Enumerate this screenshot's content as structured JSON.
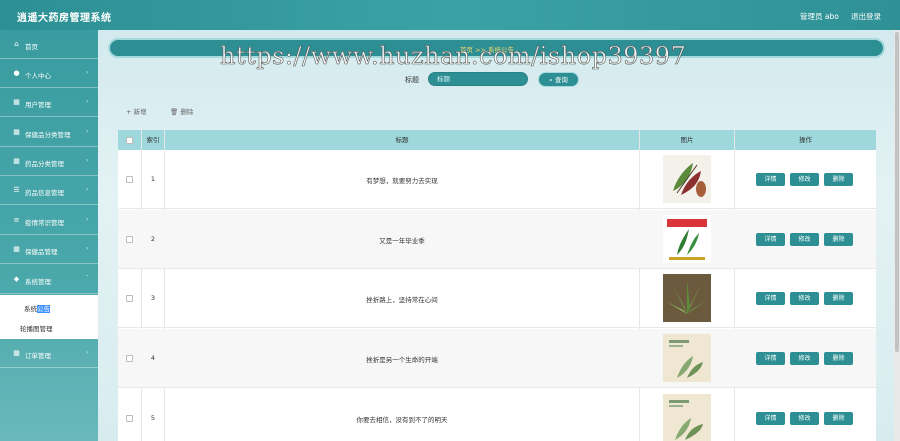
{
  "header": {
    "title": "逍遥大药房管理系统",
    "user_label": "管理员 abo",
    "logout_label": "退出登录"
  },
  "sidebar": {
    "items": [
      {
        "label": "首页",
        "icon": "home-icon"
      },
      {
        "label": "个人中心",
        "icon": "user-icon"
      },
      {
        "label": "用户管理",
        "icon": "grid-icon"
      },
      {
        "label": "保健品分类管理",
        "icon": "grid-icon"
      },
      {
        "label": "药品分类管理",
        "icon": "grid-icon"
      },
      {
        "label": "药品信息管理",
        "icon": "sliders-icon"
      },
      {
        "label": "疫情常识管理",
        "icon": "list-icon"
      },
      {
        "label": "保健品管理",
        "icon": "grid-icon"
      },
      {
        "label": "系统管理",
        "icon": "shield-icon"
      }
    ],
    "submenu": [
      {
        "label_a": "系统",
        "label_b": "公告"
      },
      {
        "label": "轮播图管理"
      }
    ],
    "after": {
      "label": "订单管理",
      "icon": "grid-icon"
    }
  },
  "breadcrumb": {
    "text": "首页 >> 系统公告"
  },
  "watermark": "https://www.huzhan.com/ishop39397",
  "search": {
    "label": "标题",
    "placeholder": "标题",
    "button": "查询"
  },
  "actions": {
    "add": "新增",
    "delete": "删除"
  },
  "table": {
    "headers": {
      "index": "索引",
      "title": "标题",
      "image": "图片",
      "ops": "操作"
    },
    "rows": [
      {
        "index": "1",
        "title": "有梦想，就要努力去实现"
      },
      {
        "index": "2",
        "title": "又是一年毕业季"
      },
      {
        "index": "3",
        "title": "挫折路上，坚持常在心间"
      },
      {
        "index": "4",
        "title": "挫折是另一个生命的开端"
      },
      {
        "index": "5",
        "title": "你要去相信，没有到不了的明天"
      }
    ],
    "buttons": {
      "detail": "详情",
      "edit": "修改",
      "delete": "删除"
    }
  },
  "colors": {
    "primary": "#2d8f94",
    "header": "#9ed8dd",
    "highlight": "#3c8fff"
  }
}
